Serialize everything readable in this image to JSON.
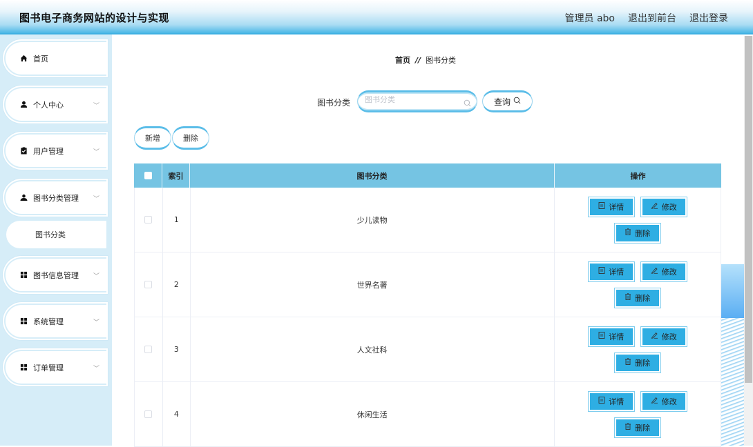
{
  "header": {
    "title": "图书电子商务网站的设计与实现",
    "nav": [
      "管理员 abo",
      "退出到前台",
      "退出登录"
    ]
  },
  "sidebar": {
    "items": [
      {
        "label": "首页",
        "icon": "home-icon",
        "has_children": false
      },
      {
        "label": "个人中心",
        "icon": "user-icon",
        "has_children": true
      },
      {
        "label": "用户管理",
        "icon": "clipboard-check-icon",
        "has_children": true
      },
      {
        "label": "图书分类管理",
        "icon": "users-icon",
        "has_children": true,
        "expanded": true,
        "children": [
          {
            "label": "图书分类"
          }
        ]
      },
      {
        "label": "图书信息管理",
        "icon": "grid-icon",
        "has_children": true
      },
      {
        "label": "系统管理",
        "icon": "grid-icon",
        "has_children": true
      },
      {
        "label": "订单管理",
        "icon": "grid-icon",
        "has_children": true
      }
    ]
  },
  "breadcrumb": {
    "home": "首页",
    "separator": "//",
    "current": "图书分类"
  },
  "search": {
    "label": "图书分类",
    "placeholder": "图书分类",
    "value": "",
    "query_button": "查询"
  },
  "actions": {
    "add": "新增",
    "delete": "删除"
  },
  "table": {
    "columns": [
      "",
      "索引",
      "图书分类",
      "操作"
    ],
    "rows": [
      {
        "index": "1",
        "category": "少儿读物"
      },
      {
        "index": "2",
        "category": "世界名著"
      },
      {
        "index": "3",
        "category": "人文社科"
      },
      {
        "index": "4",
        "category": "休闲生活"
      }
    ],
    "row_actions": {
      "detail": "详情",
      "edit": "修改",
      "delete": "删除"
    }
  },
  "colors": {
    "accent": "#2eaee3",
    "header_bottom": "#4ab7e6",
    "table_header": "#75c4e3",
    "sidebar_bg": "#d6edf8"
  }
}
